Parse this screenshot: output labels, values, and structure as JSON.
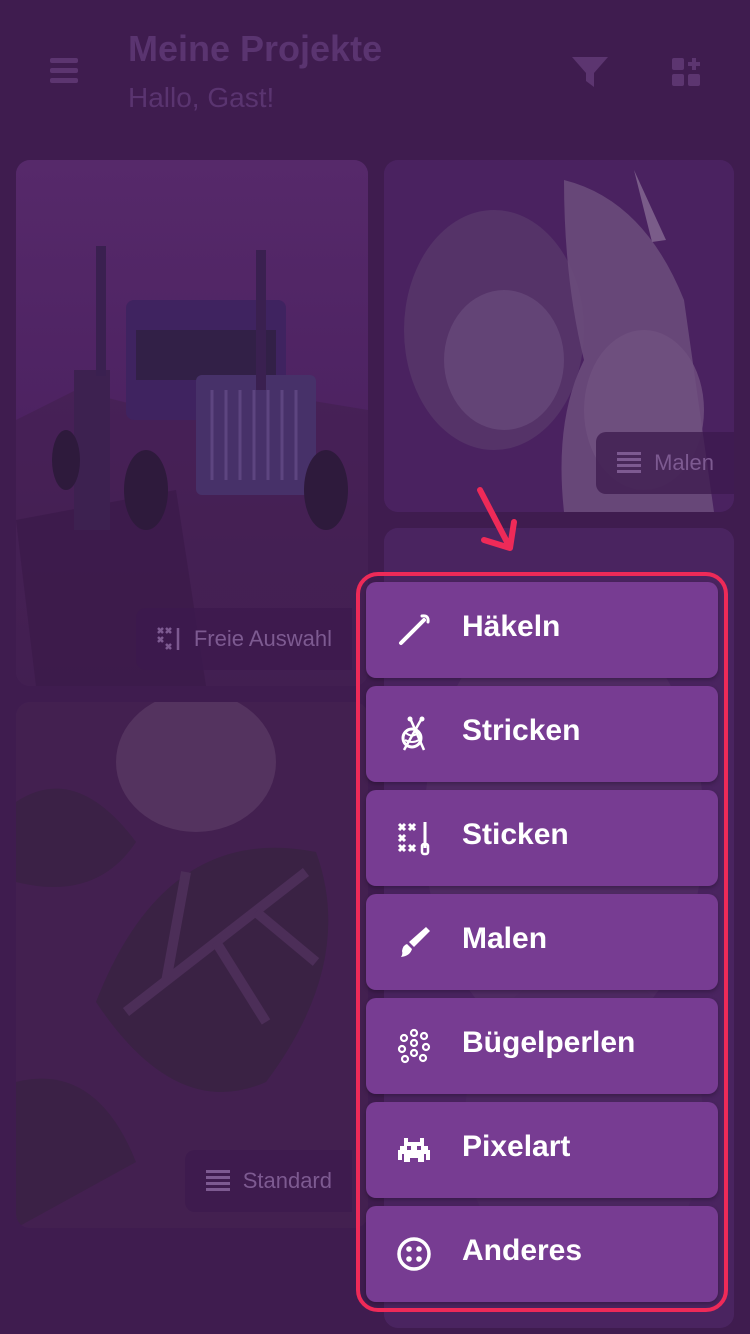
{
  "header": {
    "title": "Meine Projekte",
    "subtitle": "Hallo, Gast!"
  },
  "cards": [
    {
      "label": "Freie Auswahl",
      "icon": "cross-stitch-icon"
    },
    {
      "label": "Malen",
      "icon": "rows-icon"
    },
    {
      "label": "Standard",
      "icon": "rows-icon"
    }
  ],
  "menu": {
    "items": [
      {
        "label": "Häkeln",
        "icon": "crochet-hook-icon"
      },
      {
        "label": "Stricken",
        "icon": "yarn-ball-icon"
      },
      {
        "label": "Sticken",
        "icon": "cross-stitch-icon"
      },
      {
        "label": "Malen",
        "icon": "paintbrush-icon"
      },
      {
        "label": "Bügelperlen",
        "icon": "beads-icon"
      },
      {
        "label": "Pixelart",
        "icon": "space-invader-icon"
      },
      {
        "label": "Anderes",
        "icon": "button-icon"
      }
    ]
  },
  "colors": {
    "background": "#3f1c4f",
    "menu_item": "#773c92",
    "highlight": "#ee2a58"
  }
}
